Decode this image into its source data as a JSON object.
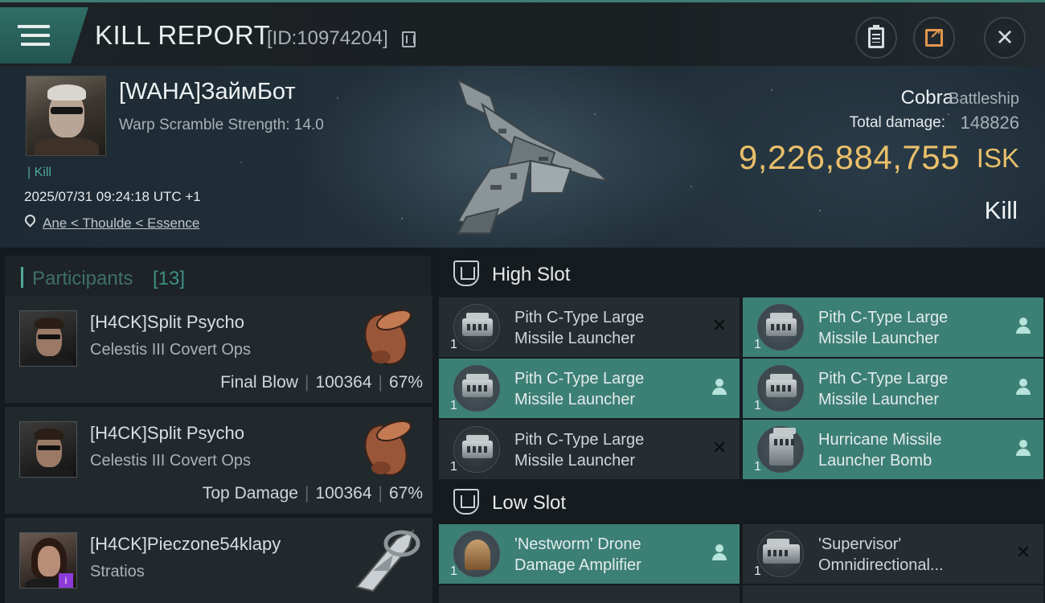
{
  "header": {
    "title": "KILL REPORT",
    "report_id": "[ID:10974204]"
  },
  "victim": {
    "name": "[WAHA]ЗаймБот",
    "warp_scramble": "Warp Scramble Strength: 14.0",
    "kill_tag": "| Kill",
    "timestamp": "2025/07/31 09:24:18 UTC +1",
    "location": "Ane < Thoulde < Essence",
    "ship_name": "Cobra",
    "ship_class": "Battleship",
    "total_damage_label": "Total damage:",
    "total_damage": "148826",
    "isk_value": "9,226,884,755",
    "isk_unit": "ISK",
    "result": "Kill"
  },
  "participants": {
    "label": "Participants",
    "count": "[13]",
    "rows": [
      {
        "name": "[H4CK]Split Psycho",
        "ship": "Celestis III Covert Ops",
        "role": "Final Blow",
        "damage": "100364",
        "percent": "67%"
      },
      {
        "name": "[H4CK]Split Psycho",
        "ship": "Celestis III Covert Ops",
        "role": "Top Damage",
        "damage": "100364",
        "percent": "67%"
      },
      {
        "name": "[H4CK]Pieczone54klapy",
        "ship": "Stratios",
        "badge": "i"
      }
    ]
  },
  "high_slot": {
    "title": "High Slot",
    "modules": [
      {
        "name": "Pith C-Type Large Missile Launcher",
        "qty": "1",
        "status": "destroyed",
        "glyph": "✕"
      },
      {
        "name": "Pith C-Type Large Missile Launcher",
        "qty": "1",
        "status": "dropped"
      },
      {
        "name": "Pith C-Type Large Missile Launcher",
        "qty": "1",
        "status": "dropped"
      },
      {
        "name": "Pith C-Type Large Missile Launcher",
        "qty": "1",
        "status": "dropped"
      },
      {
        "name": "Pith C-Type Large Missile Launcher",
        "qty": "1",
        "status": "destroyed",
        "glyph": "✕"
      },
      {
        "name": "Hurricane Missile Launcher Bomb",
        "qty": "1",
        "status": "dropped"
      }
    ]
  },
  "low_slot": {
    "title": "Low Slot",
    "modules": [
      {
        "name": "'Nestworm' Drone Damage Amplifier",
        "qty": "1",
        "status": "dropped"
      },
      {
        "name": "'Supervisor' Omnidirectional...",
        "qty": "1",
        "status": "destroyed",
        "glyph": "✕"
      }
    ]
  },
  "colors": {
    "accent": "#3c7f75",
    "isk_gold": "#e9bf6a",
    "background": "#14181c"
  },
  "icons": [
    "menu-icon",
    "copy-icon",
    "clipboard-icon",
    "share-icon",
    "close-icon",
    "location-pin-icon",
    "slot-icon",
    "destroyed-icon",
    "dropped-icon"
  ]
}
